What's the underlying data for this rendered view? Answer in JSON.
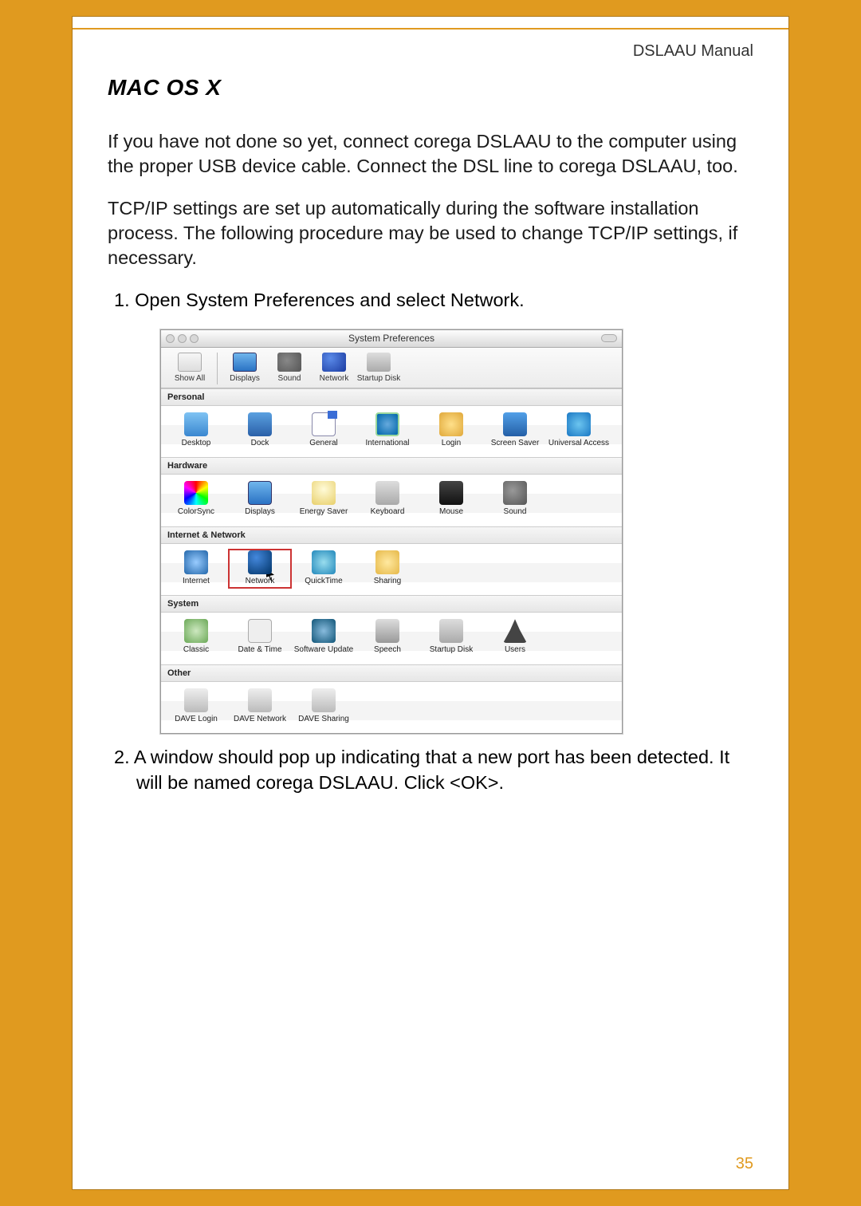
{
  "header": {
    "manual": "DSLAAU Manual"
  },
  "section": {
    "title": "MAC OS X"
  },
  "para1": "If you have not done so yet, connect corega DSLAAU to the computer using the proper USB device cable.  Connect the DSL line to corega DSLAAU, too.",
  "para2": "TCP/IP settings are set up automatically during the software installation process. The following procedure may be used to change TCP/IP settings, if necessary.",
  "step1": "1.  Open System Preferences and select Network.",
  "step2": "2.  A window should pop up indicating that a new port has been detected.  It will be named corega DSLAAU.  Click <OK>.",
  "page_number": "35",
  "window": {
    "title": "System Preferences",
    "toolbar": [
      {
        "label": "Show All",
        "icon": "i-show"
      },
      {
        "label": "Displays",
        "icon": "i-monitor"
      },
      {
        "label": "Sound",
        "icon": "i-sound"
      },
      {
        "label": "Network",
        "icon": "i-globe"
      },
      {
        "label": "Startup Disk",
        "icon": "i-disk"
      }
    ],
    "sections": [
      {
        "name": "Personal",
        "items": [
          {
            "label": "Desktop",
            "icon": "i-desktop"
          },
          {
            "label": "Dock",
            "icon": "i-dock"
          },
          {
            "label": "General",
            "icon": "i-gen"
          },
          {
            "label": "International",
            "icon": "i-intl"
          },
          {
            "label": "Login",
            "icon": "i-login"
          },
          {
            "label": "Screen Saver",
            "icon": "i-saver"
          },
          {
            "label": "Universal Access",
            "icon": "i-ua"
          }
        ]
      },
      {
        "name": "Hardware",
        "items": [
          {
            "label": "ColorSync",
            "icon": "i-cs"
          },
          {
            "label": "Displays",
            "icon": "i-monitor"
          },
          {
            "label": "Energy Saver",
            "icon": "i-bulb"
          },
          {
            "label": "Keyboard",
            "icon": "i-kb"
          },
          {
            "label": "Mouse",
            "icon": "i-mouse"
          },
          {
            "label": "Sound",
            "icon": "i-snd2"
          }
        ]
      },
      {
        "name": "Internet & Network",
        "items": [
          {
            "label": "Internet",
            "icon": "i-internet"
          },
          {
            "label": "Network",
            "icon": "i-net",
            "highlight": true,
            "cursor": true
          },
          {
            "label": "QuickTime",
            "icon": "i-qt"
          },
          {
            "label": "Sharing",
            "icon": "i-share"
          }
        ]
      },
      {
        "name": "System",
        "items": [
          {
            "label": "Classic",
            "icon": "i-classic"
          },
          {
            "label": "Date & Time",
            "icon": "i-dt"
          },
          {
            "label": "Software Update",
            "icon": "i-su"
          },
          {
            "label": "Speech",
            "icon": "i-speech"
          },
          {
            "label": "Startup Disk",
            "icon": "i-sdisk"
          },
          {
            "label": "Users",
            "icon": "i-users"
          }
        ]
      },
      {
        "name": "Other",
        "items": [
          {
            "label": "DAVE Login",
            "icon": "i-dave"
          },
          {
            "label": "DAVE Network",
            "icon": "i-dave"
          },
          {
            "label": "DAVE Sharing",
            "icon": "i-dave"
          }
        ]
      }
    ]
  }
}
